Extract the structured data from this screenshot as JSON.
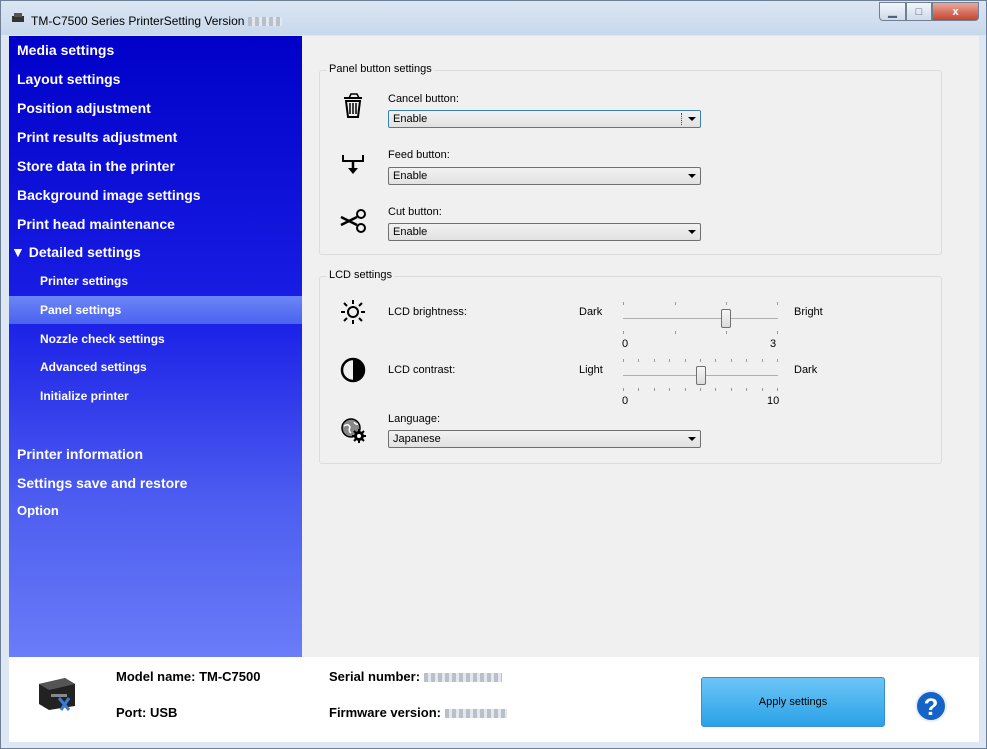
{
  "window": {
    "title": "TM-C7500 Series PrinterSetting Version",
    "min_glyph": "▁",
    "max_glyph": "□",
    "close_glyph": "x"
  },
  "sidebar": {
    "items": [
      {
        "label": "Media settings"
      },
      {
        "label": "Layout settings"
      },
      {
        "label": "Position adjustment"
      },
      {
        "label": "Print results adjustment"
      },
      {
        "label": "Store data in the printer"
      },
      {
        "label": "Background image settings"
      },
      {
        "label": "Print head maintenance"
      },
      {
        "label": "▼ Detailed settings"
      }
    ],
    "subitems": [
      {
        "label": "Printer settings"
      },
      {
        "label": "Panel settings",
        "selected": true
      },
      {
        "label": "Nozzle check settings"
      },
      {
        "label": "Advanced settings"
      },
      {
        "label": "Initialize printer"
      }
    ],
    "lower_items": [
      {
        "label": "Printer information"
      },
      {
        "label": "Settings save and restore"
      },
      {
        "label": "Option"
      }
    ]
  },
  "panel_buttons": {
    "group_title": "Panel button settings",
    "cancel": {
      "label": "Cancel button:",
      "value": "Enable",
      "icon": "trash-icon"
    },
    "feed": {
      "label": "Feed button:",
      "value": "Enable",
      "icon": "feed-icon"
    },
    "cut": {
      "label": "Cut button:",
      "value": "Enable",
      "icon": "scissors-icon"
    }
  },
  "lcd": {
    "group_title": "LCD settings",
    "brightness": {
      "label": "LCD brightness:",
      "left": "Dark",
      "right": "Bright",
      "min": "0",
      "max": "3",
      "value": 2
    },
    "contrast": {
      "label": "LCD contrast:",
      "left": "Light",
      "right": "Dark",
      "min": "0",
      "max": "10",
      "value": 5
    },
    "language": {
      "label": "Language:",
      "value": "Japanese"
    }
  },
  "footer": {
    "model": "Model name: TM-C7500",
    "port": "Port: USB",
    "serial_label": "Serial number:",
    "firmware_label": "Firmware version:",
    "apply": "Apply settings",
    "help": "?"
  },
  "colors": {
    "sidebar_top": "#0000c8",
    "sidebar_bottom": "#6a7cf8",
    "apply_button": "#2aa2e8",
    "help_button": "#1463c8"
  }
}
